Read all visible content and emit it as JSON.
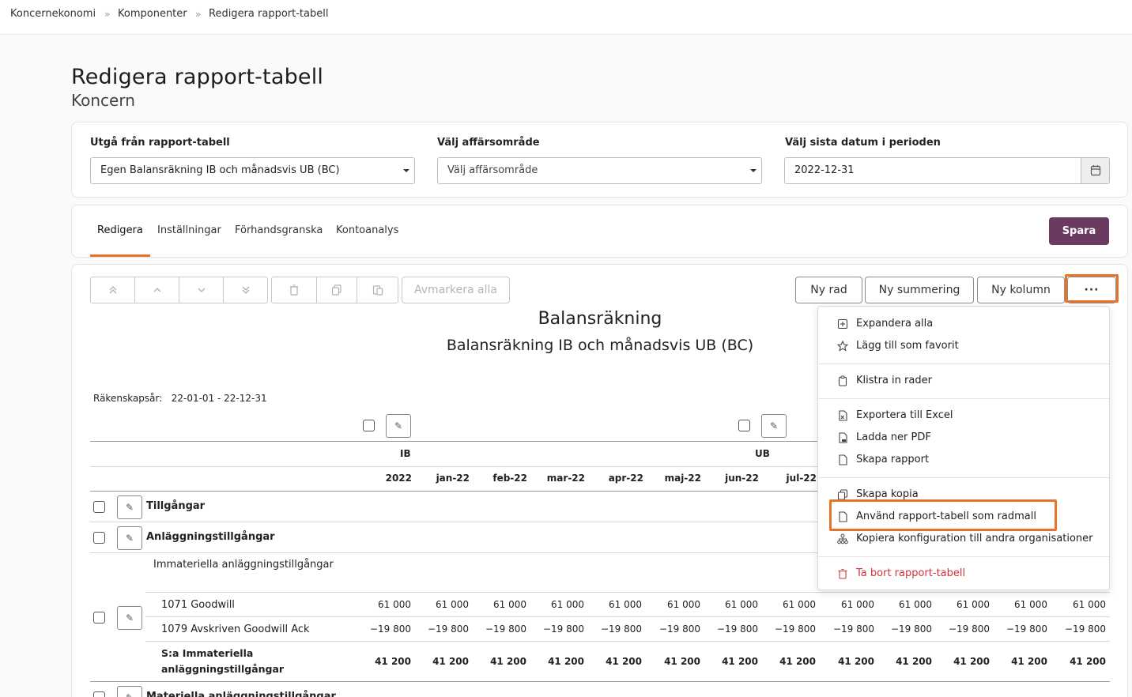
{
  "breadcrumb": [
    "Koncernekonomi",
    "»",
    "Komponenter",
    "»",
    "Redigera rapport-tabell"
  ],
  "page": {
    "title": "Redigera rapport-tabell",
    "subtitle": "Koncern"
  },
  "filters": {
    "report_label": "Utgå från rapport-tabell",
    "report_value": "Egen Balansräkning IB och månadsvis UB (BC)",
    "area_label": "Välj affärsområde",
    "area_value": "Välj affärsområde",
    "date_label": "Välj sista datum i perioden",
    "date_value": "2022-12-31"
  },
  "tabs": [
    "Redigera",
    "Inställningar",
    "Förhandsgranska",
    "Kontoanalys"
  ],
  "save_label": "Spara",
  "toolbar": {
    "deselect_label": "Avmarkera alla",
    "new_row": "Ny rad",
    "new_sum": "Ny summering",
    "new_col": "Ny kolumn",
    "more": "···"
  },
  "report": {
    "title": "Balansräkning",
    "subtitle": "Balansräkning IB och månadsvis UB (BC)",
    "period_label": "Räkenskapsår:",
    "period_value": "22-01-01 - 22-12-31"
  },
  "table": {
    "groups": [
      "IB",
      "UB"
    ],
    "columns": [
      "2022",
      "jan-22",
      "feb-22",
      "mar-22",
      "apr-22",
      "maj-22",
      "jun-22",
      "jul-22"
    ],
    "rows": {
      "assets": "Tillgångar",
      "fixed": "Anläggningstillgångar",
      "intangible": "Immateriella anläggningstillgångar",
      "goodwill": "1071 Goodwill",
      "goodwill_dep": "1079 Avskriven Goodwill Ack",
      "sum_line1": "S:a Immateriella",
      "sum_line2": "anläggningstillgångar",
      "tangible": "Materiella anläggningstillgångar"
    },
    "values_goodwill": [
      "61 000",
      "61 000",
      "61 000",
      "61 000",
      "61 000",
      "61 000",
      "61 000",
      "61 000",
      "61 000",
      "61 000",
      "61 000",
      "61 000",
      "61 000"
    ],
    "values_dep": [
      "−19 800",
      "−19 800",
      "−19 800",
      "−19 800",
      "−19 800",
      "−19 800",
      "−19 800",
      "−19 800",
      "−19 800",
      "−19 800",
      "−19 800",
      "−19 800",
      "−19 800"
    ],
    "values_sum": [
      "41 200",
      "41 200",
      "41 200",
      "41 200",
      "41 200",
      "41 200",
      "41 200",
      "41 200",
      "41 200",
      "41 200",
      "41 200",
      "41 200",
      "41 200"
    ]
  },
  "menu": {
    "items": [
      {
        "label": "Expandera alla",
        "icon": "plus-square-icon"
      },
      {
        "label": "Lägg till som favorit",
        "icon": "star-icon"
      },
      {
        "label": "Klistra in rader",
        "icon": "clipboard-icon"
      },
      {
        "label": "Exportera till Excel",
        "icon": "excel-file-icon"
      },
      {
        "label": "Ladda ner PDF",
        "icon": "pdf-file-icon"
      },
      {
        "label": "Skapa rapport",
        "icon": "file-icon"
      },
      {
        "label": "Skapa kopia",
        "icon": "copy-icon"
      },
      {
        "label": "Använd rapport-tabell som radmall",
        "icon": "file-icon"
      },
      {
        "label": "Kopiera konfiguration till andra organisationer",
        "icon": "org-tree-icon"
      },
      {
        "label": "Ta bort rapport-tabell",
        "icon": "trash-icon"
      }
    ]
  },
  "colors": {
    "accent": "#e8742a",
    "primary": "#6b3a61",
    "danger": "#d0333b"
  }
}
